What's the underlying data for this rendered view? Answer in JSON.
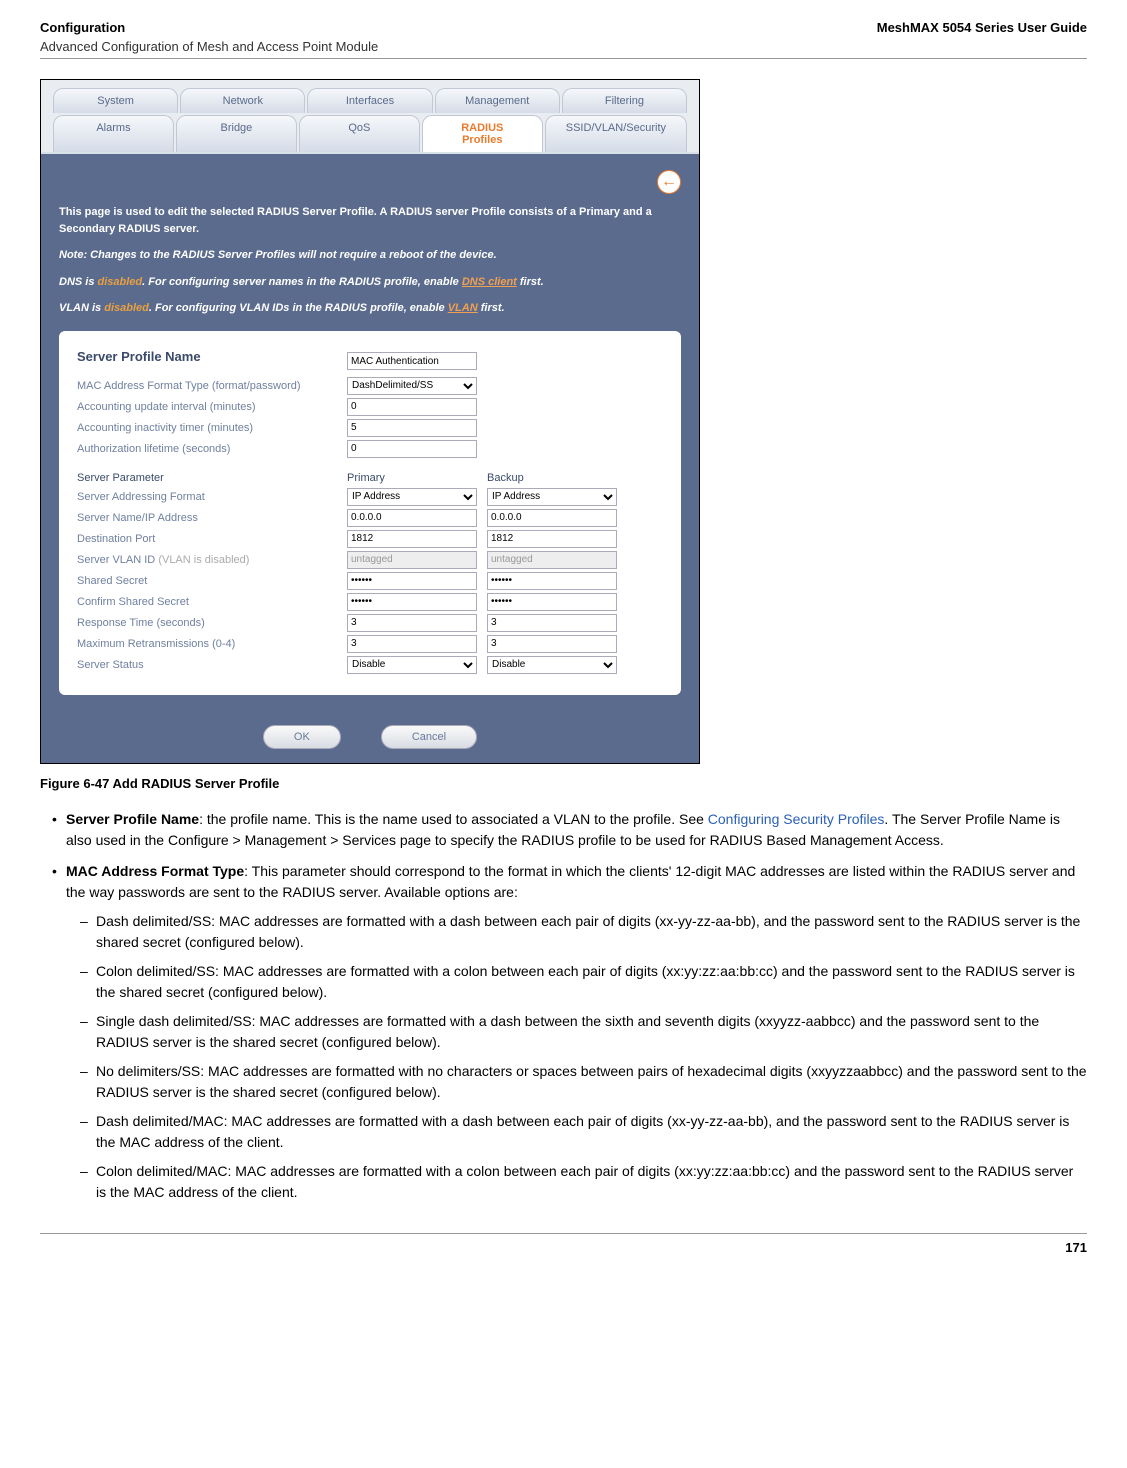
{
  "header": {
    "left_title": "Configuration",
    "left_subtitle": "Advanced Configuration of Mesh and Access Point Module",
    "right_title": "MeshMAX 5054 Series User Guide"
  },
  "tabs": {
    "row1": [
      "System",
      "Network",
      "Interfaces",
      "Management",
      "Filtering"
    ],
    "row2": [
      "Alarms",
      "Bridge",
      "QoS",
      "RADIUS Profiles",
      "SSID/VLAN/Security"
    ],
    "active": "RADIUS Profiles"
  },
  "back_icon": "←",
  "intro": {
    "p1": "This page is used to edit the selected RADIUS Server Profile. A RADIUS server Profile consists of a Primary and a Secondary RADIUS server.",
    "p2": "Note: Changes to the RADIUS Server Profiles will not require a reboot of the device.",
    "p3a": "DNS is ",
    "p3b": "disabled",
    "p3c": ". For configuring server names in the RADIUS profile, enable ",
    "p3d": "DNS client",
    "p3e": " first.",
    "p4a": "VLAN is ",
    "p4b": "disabled",
    "p4c": ". For configuring VLAN IDs in the RADIUS profile, enable ",
    "p4d": "VLAN",
    "p4e": " first."
  },
  "form": {
    "heading": "Server Profile Name",
    "profile_name_value": "MAC Authentication",
    "rows": [
      {
        "label": "MAC Address Format Type (format/password)",
        "type": "select",
        "value": "DashDelimited/SS"
      },
      {
        "label": "Accounting update interval (minutes)",
        "type": "text",
        "value": "0"
      },
      {
        "label": "Accounting inactivity timer (minutes)",
        "type": "text",
        "value": "5"
      },
      {
        "label": "Authorization lifetime (seconds)",
        "type": "text",
        "value": "0"
      }
    ],
    "param_heading": "Server Parameter",
    "primary_heading": "Primary",
    "backup_heading": "Backup",
    "param_rows": [
      {
        "label": "Server Addressing Format",
        "type": "select",
        "p": "IP Address",
        "b": "IP Address"
      },
      {
        "label": "Server Name/IP Address",
        "type": "text",
        "p": "0.0.0.0",
        "b": "0.0.0.0"
      },
      {
        "label": "Destination Port",
        "type": "text",
        "p": "1812",
        "b": "1812"
      },
      {
        "label": "Server VLAN ID",
        "muted": "(VLAN is disabled)",
        "type": "text",
        "p": "untagged",
        "b": "untagged",
        "disabled": true
      },
      {
        "label": "Shared Secret",
        "type": "password",
        "p": "••••••",
        "b": "••••••"
      },
      {
        "label": "Confirm Shared Secret",
        "type": "password",
        "p": "••••••",
        "b": "••••••"
      },
      {
        "label": "Response Time (seconds)",
        "type": "text",
        "p": "3",
        "b": "3"
      },
      {
        "label": "Maximum Retransmissions (0-4)",
        "type": "text",
        "p": "3",
        "b": "3"
      },
      {
        "label": "Server Status",
        "type": "select",
        "p": "Disable",
        "b": "Disable"
      }
    ],
    "ok_label": "OK",
    "cancel_label": "Cancel"
  },
  "figure_caption": "Figure 6-47 Add RADIUS Server Profile",
  "bullets": {
    "b1_lead": "Server Profile Name",
    "b1_text_a": ": the profile name. This is the name used to associated a VLAN to the profile. See ",
    "b1_link": "Configuring Security Profiles",
    "b1_text_b": ". The Server Profile Name is also used in the Configure > Management > Services page to specify the RADIUS profile to be used for RADIUS Based Management Access.",
    "b2_lead": "MAC Address Format Type",
    "b2_text": ": This parameter should correspond to the format in which the clients' 12-digit MAC addresses are listed within the RADIUS server and the way passwords are sent to the RADIUS server. Available options are:",
    "sub": [
      "Dash delimited/SS: MAC addresses are formatted with a dash between each pair of digits (xx-yy-zz-aa-bb), and the password sent to the RADIUS server is the shared secret (configured below).",
      "Colon delimited/SS: MAC addresses are formatted with a colon between each pair of digits (xx:yy:zz:aa:bb:cc) and the password sent to the RADIUS server is the shared secret (configured below).",
      "Single dash delimited/SS: MAC addresses are formatted with a dash between the sixth and seventh digits (xxyyzz-aabbcc) and the password sent to the RADIUS server is the shared secret (configured below).",
      "No delimiters/SS: MAC addresses are formatted with no characters or spaces between pairs of hexadecimal digits (xxyyzzaabbcc) and the password sent to the RADIUS server is the shared secret (configured below).",
      "Dash delimited/MAC: MAC addresses are formatted with a dash between each pair of digits (xx-yy-zz-aa-bb), and the password sent to the RADIUS server is the MAC address of the client.",
      "Colon delimited/MAC: MAC addresses are formatted with a colon between each pair of digits (xx:yy:zz:aa:bb:cc) and the password sent to the RADIUS server is the MAC address of the client."
    ]
  },
  "page_number": "171"
}
